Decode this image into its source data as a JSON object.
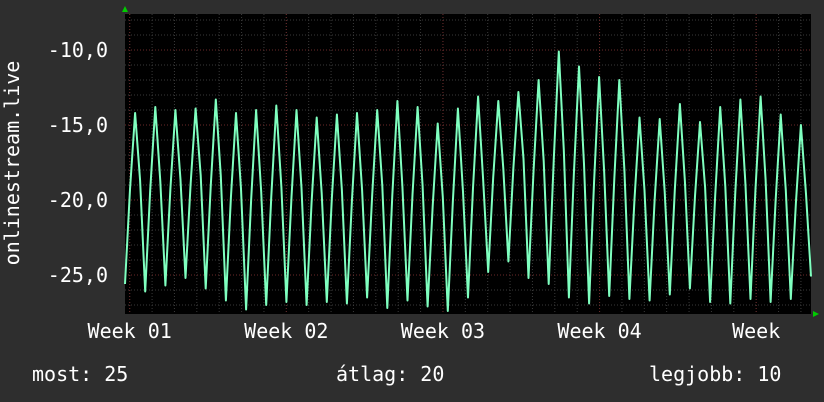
{
  "chart_data": {
    "type": "line",
    "title": "",
    "xlabel": "",
    "ylabel": "onlinestream.live",
    "ylim": [
      -27.6,
      -7.6
    ],
    "y_ticks": [
      {
        "value": -10,
        "label": "-10,0"
      },
      {
        "value": -15,
        "label": "-15,0"
      },
      {
        "value": -20,
        "label": "-20,0"
      },
      {
        "value": -25,
        "label": "-25,0"
      }
    ],
    "x_ticks": [
      {
        "value": 1,
        "label": "Week 01"
      },
      {
        "value": 2,
        "label": "Week 02"
      },
      {
        "value": 3,
        "label": "Week 03"
      },
      {
        "value": 4,
        "label": "Week 04"
      },
      {
        "value": 5,
        "label": "Week"
      }
    ],
    "xlim": [
      0.97,
      5.35
    ],
    "grid": true,
    "series": [
      {
        "name": "",
        "color": "#7fffbf",
        "x_start": 0.97,
        "x_end": 5.35,
        "peaks": [
          -14.2,
          -13.8,
          -14.0,
          -13.9,
          -13.3,
          -14.2,
          -14.0,
          -13.7,
          -14.0,
          -14.5,
          -14.3,
          -14.2,
          -14.0,
          -13.4,
          -13.8,
          -14.9,
          -13.9,
          -13.1,
          -13.4,
          -12.8,
          -12.0,
          -10.1,
          -11.1,
          -11.8,
          -12.0,
          -14.5,
          -14.6,
          -13.6,
          -14.8,
          -13.8,
          -13.3,
          -13.1,
          -14.3,
          -15.0
        ],
        "troughs": [
          -25.6,
          -26.1,
          -25.7,
          -25.2,
          -25.9,
          -26.7,
          -27.3,
          -27.0,
          -26.8,
          -27.0,
          -26.8,
          -26.9,
          -26.5,
          -27.2,
          -26.7,
          -27.1,
          -27.4,
          -26.5,
          -24.8,
          -24.1,
          -25.2,
          -25.6,
          -26.5,
          -26.9,
          -26.4,
          -26.6,
          -26.7,
          -26.3,
          -25.9,
          -26.8,
          -26.9,
          -26.6,
          -26.8,
          -26.6
        ]
      }
    ]
  },
  "stats": {
    "now": "most: 25",
    "avg": "átlag: 20",
    "max": "legjobb: 10"
  },
  "colors": {
    "background": "#2e2e2e",
    "plot_background": "#000000",
    "grid_minor": "#3a3a3a",
    "grid_major": "#6b2a2a",
    "line": "#7fffbf",
    "axis": "#ffffff",
    "arrow": "#00cc00"
  }
}
